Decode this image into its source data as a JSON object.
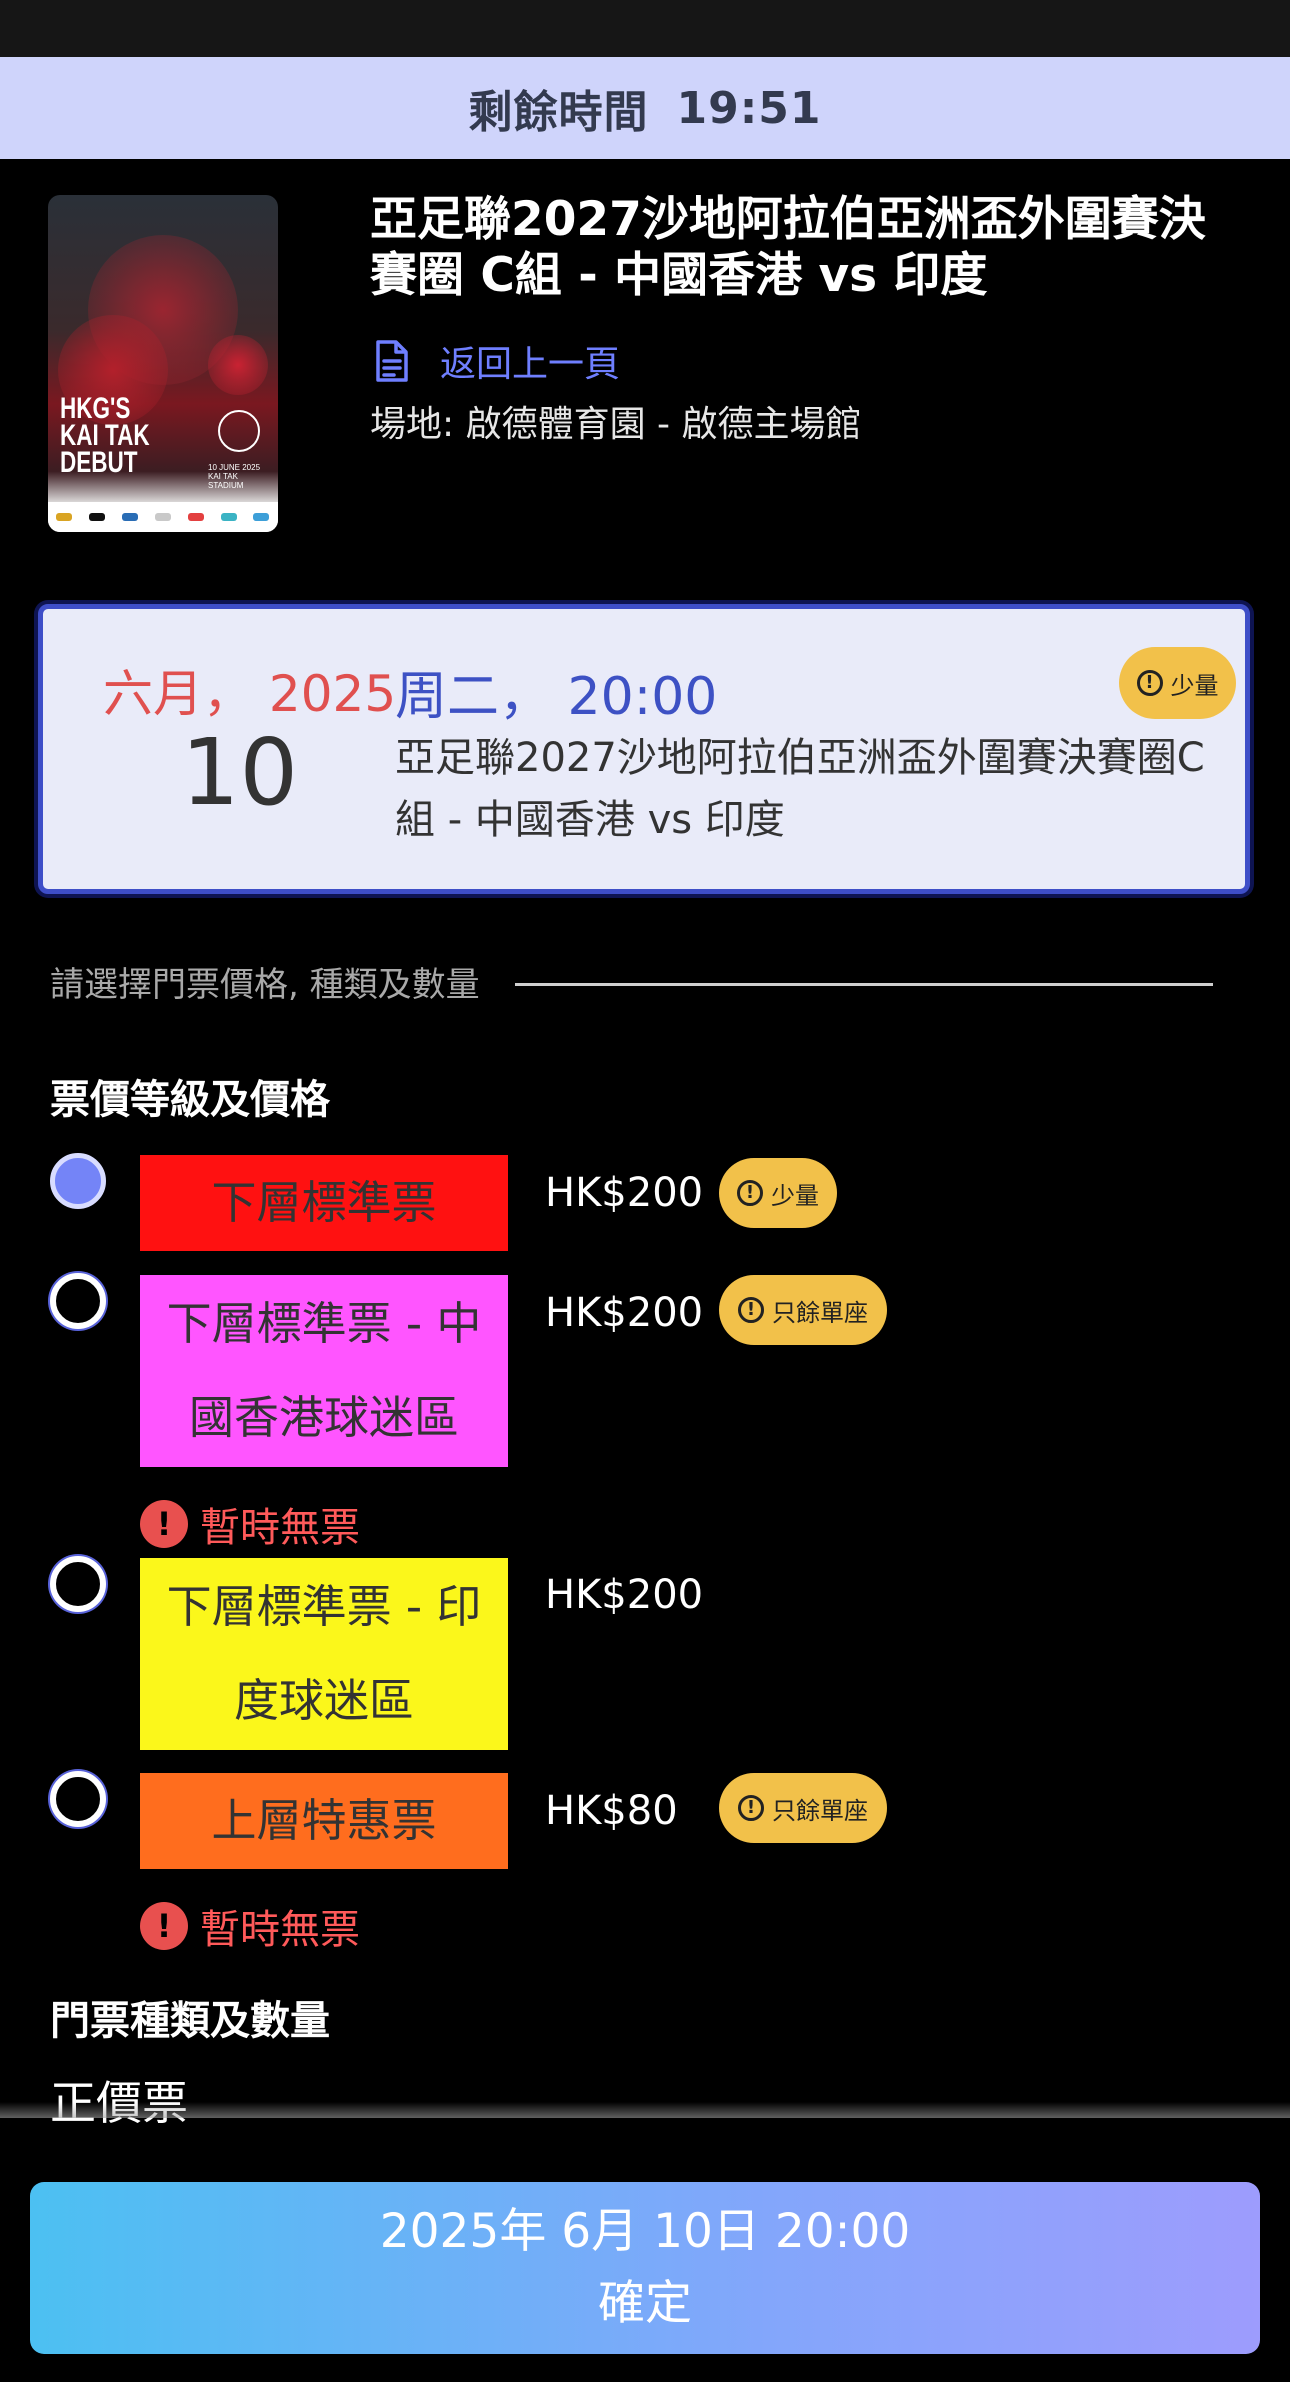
{
  "timer": {
    "label": "剩餘時間",
    "value": "19:51"
  },
  "poster": {
    "headline": "HKG'S KAI TAK DEBUT",
    "date_line": "10 JUNE 2025 KAI TAK STADIUM"
  },
  "event": {
    "title": "亞足聯2027沙地阿拉伯亞洲盃外圍賽決賽圈 C組 - 中國香港 vs 印度",
    "back_label": "返回上一頁",
    "venue": "場地: 啟德體育園 - 啟德主場館"
  },
  "date_card": {
    "month_year": "六月， 2025",
    "day": "10",
    "weekday_time": "周二， 20:00",
    "description": "亞足聯2027沙地阿拉伯亞洲盃外圍賽決賽圈C組 - 中國香港 vs 印度",
    "badge": "少量"
  },
  "section_hint": "請選擇門票價格, 種類及數量",
  "price_heading": "票價等級及價格",
  "tiers": [
    {
      "name": "下層標準票",
      "price": "HK$200",
      "badge": "少量",
      "color": "#ff1111",
      "selected": true,
      "warning": ""
    },
    {
      "name": "下層標準票 - 中國香港球迷區",
      "price": "HK$200",
      "badge": "只餘單座",
      "color": "#ff55ff",
      "selected": false,
      "warning": "暫時無票"
    },
    {
      "name": "下層標準票 - 印度球迷區",
      "price": "HK$200",
      "badge": "",
      "color": "#fbf71b",
      "selected": false,
      "warning": ""
    },
    {
      "name": "上層特惠票",
      "price": "HK$80",
      "badge": "只餘單座",
      "color": "#ff6d1e",
      "selected": false,
      "warning": "暫時無票"
    }
  ],
  "ticket_heading": "門票種類及數量",
  "ticket_type": "正價票",
  "confirm": {
    "datetime": "2025年 6月 10日 20:00",
    "label": "確定"
  },
  "colors": {
    "accent": "#3e4ec8",
    "badge": "#f2c14a",
    "warning": "#ff5a5a"
  }
}
